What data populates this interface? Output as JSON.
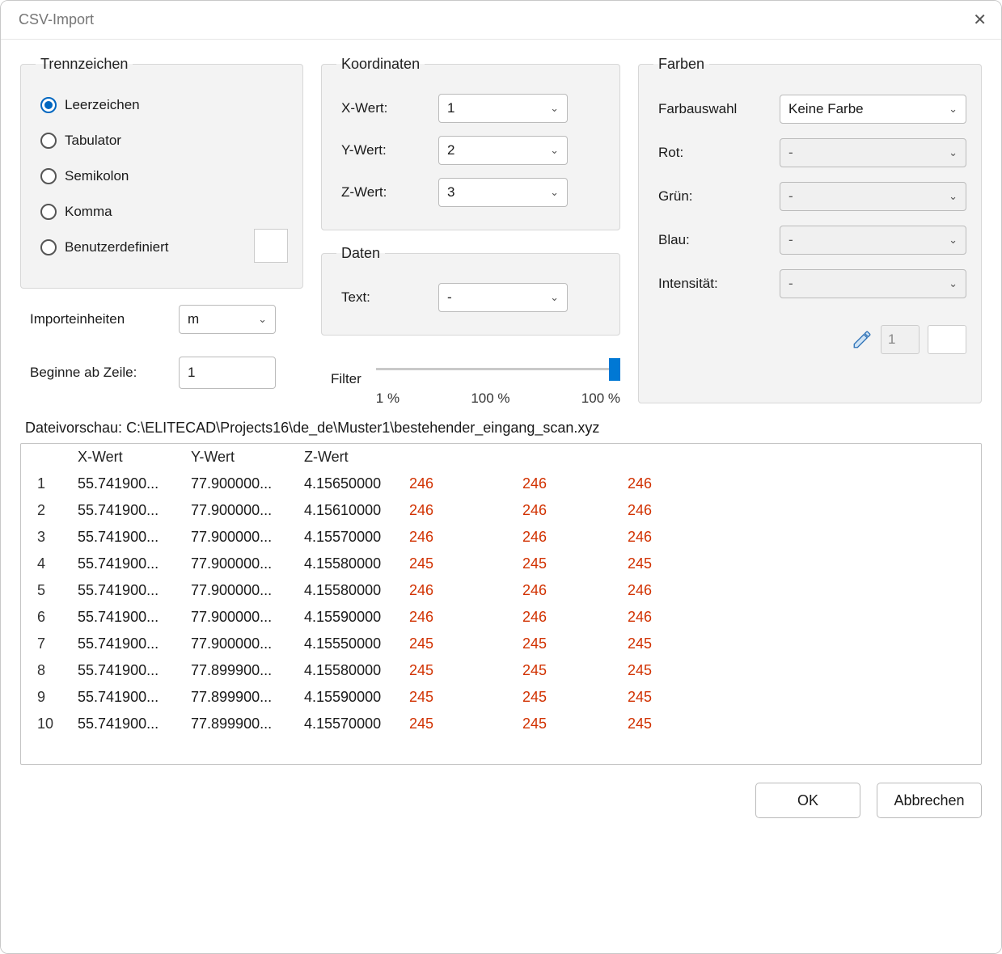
{
  "window": {
    "title": "CSV-Import"
  },
  "trennzeichen": {
    "legend": "Trennzeichen",
    "options": {
      "leerzeichen": "Leerzeichen",
      "tabulator": "Tabulator",
      "semikolon": "Semikolon",
      "komma": "Komma",
      "benutzerdefiniert": "Benutzerdefiniert"
    },
    "selected": "leerzeichen"
  },
  "importeinheiten": {
    "label": "Importeinheiten",
    "value": "m"
  },
  "beginne": {
    "label": "Beginne ab Zeile:",
    "value": "1"
  },
  "koordinaten": {
    "legend": "Koordinaten",
    "x": {
      "label": "X-Wert:",
      "value": "1"
    },
    "y": {
      "label": "Y-Wert:",
      "value": "2"
    },
    "z": {
      "label": "Z-Wert:",
      "value": "3"
    }
  },
  "daten": {
    "legend": "Daten",
    "text": {
      "label": "Text:",
      "value": "-"
    }
  },
  "filter": {
    "label": "Filter",
    "ticks": {
      "low": "1 %",
      "mid": "100 %",
      "high": "100 %"
    }
  },
  "farben": {
    "legend": "Farben",
    "auswahl": {
      "label": "Farbauswahl",
      "value": "Keine Farbe"
    },
    "rot": {
      "label": "Rot:",
      "value": "-"
    },
    "gruen": {
      "label": "Grün:",
      "value": "-"
    },
    "blau": {
      "label": "Blau:",
      "value": "-"
    },
    "intens": {
      "label": "Intensität:",
      "value": "-"
    },
    "pencil_value": "1"
  },
  "preview": {
    "label_prefix": "Dateivorschau: ",
    "path": "C:\\ELITECAD\\Projects16\\de_de\\Muster1\\bestehender_eingang_scan.xyz",
    "headers": {
      "x": "X-Wert",
      "y": "Y-Wert",
      "z": "Z-Wert"
    },
    "rows": [
      {
        "n": "1",
        "x": "55.741900...",
        "y": "77.900000...",
        "z": "4.15650000",
        "r": "246",
        "g": "246",
        "b": "246"
      },
      {
        "n": "2",
        "x": "55.741900...",
        "y": "77.900000...",
        "z": "4.15610000",
        "r": "246",
        "g": "246",
        "b": "246"
      },
      {
        "n": "3",
        "x": "55.741900...",
        "y": "77.900000...",
        "z": "4.15570000",
        "r": "246",
        "g": "246",
        "b": "246"
      },
      {
        "n": "4",
        "x": "55.741900...",
        "y": "77.900000...",
        "z": "4.15580000",
        "r": "245",
        "g": "245",
        "b": "245"
      },
      {
        "n": "5",
        "x": "55.741900...",
        "y": "77.900000...",
        "z": "4.15580000",
        "r": "246",
        "g": "246",
        "b": "246"
      },
      {
        "n": "6",
        "x": "55.741900...",
        "y": "77.900000...",
        "z": "4.15590000",
        "r": "246",
        "g": "246",
        "b": "246"
      },
      {
        "n": "7",
        "x": "55.741900...",
        "y": "77.900000...",
        "z": "4.15550000",
        "r": "245",
        "g": "245",
        "b": "245"
      },
      {
        "n": "8",
        "x": "55.741900...",
        "y": "77.899900...",
        "z": "4.15580000",
        "r": "245",
        "g": "245",
        "b": "245"
      },
      {
        "n": "9",
        "x": "55.741900...",
        "y": "77.899900...",
        "z": "4.15590000",
        "r": "245",
        "g": "245",
        "b": "245"
      },
      {
        "n": "10",
        "x": "55.741900...",
        "y": "77.899900...",
        "z": "4.15570000",
        "r": "245",
        "g": "245",
        "b": "245"
      }
    ]
  },
  "buttons": {
    "ok": "OK",
    "cancel": "Abbrechen"
  }
}
